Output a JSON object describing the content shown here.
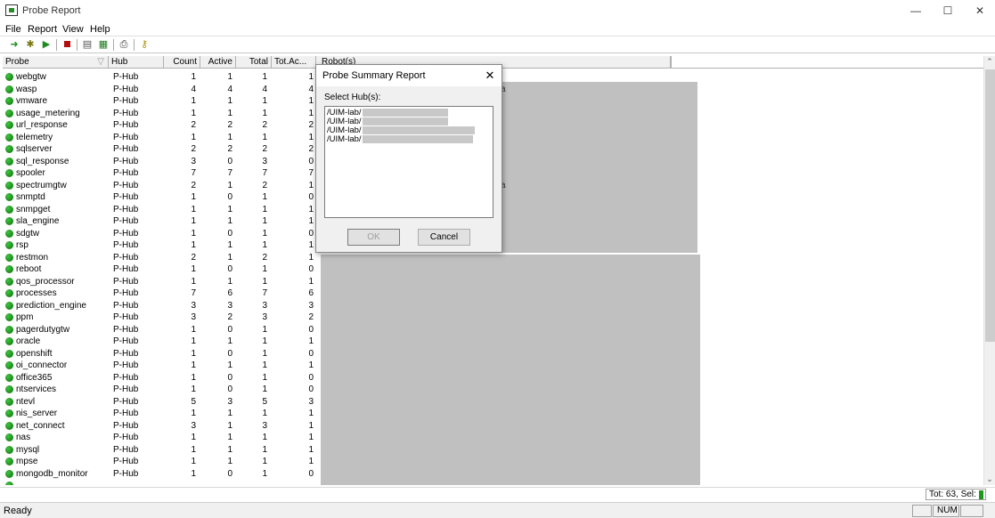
{
  "window": {
    "title": "Probe Report",
    "minimize": "—",
    "maximize": "☐",
    "close": "✕"
  },
  "menu": [
    "File",
    "Report",
    "View",
    "Help"
  ],
  "toolbar": {
    "buttons": [
      "run-green-icon",
      "settings-gear-icon",
      "forward-icon",
      "stop-red-icon",
      "print-preview-icon",
      "export-excel-icon",
      "print-icon",
      "key-icon"
    ]
  },
  "columns": {
    "probe": "Probe",
    "probe_sort": "▽",
    "hub": "Hub",
    "count": "Count",
    "active": "Active",
    "total": "Total",
    "totac": "Tot.Ac...",
    "robots": "Robot(s)"
  },
  "rows": [
    {
      "probe": "webgtw",
      "hub": "P-Hub",
      "count": "1",
      "active": "1",
      "total": "1",
      "totac": "1"
    },
    {
      "probe": "wasp",
      "hub": "P-Hub",
      "count": "4",
      "active": "4",
      "total": "4",
      "totac": "4"
    },
    {
      "probe": "vmware",
      "hub": "P-Hub",
      "count": "1",
      "active": "1",
      "total": "1",
      "totac": "1"
    },
    {
      "probe": "usage_metering",
      "hub": "P-Hub",
      "count": "1",
      "active": "1",
      "total": "1",
      "totac": "1"
    },
    {
      "probe": "url_response",
      "hub": "P-Hub",
      "count": "2",
      "active": "2",
      "total": "2",
      "totac": "2"
    },
    {
      "probe": "telemetry",
      "hub": "P-Hub",
      "count": "1",
      "active": "1",
      "total": "1",
      "totac": "1"
    },
    {
      "probe": "sqlserver",
      "hub": "P-Hub",
      "count": "2",
      "active": "2",
      "total": "2",
      "totac": "2"
    },
    {
      "probe": "sql_response",
      "hub": "P-Hub",
      "count": "3",
      "active": "0",
      "total": "3",
      "totac": "0"
    },
    {
      "probe": "spooler",
      "hub": "P-Hub",
      "count": "7",
      "active": "7",
      "total": "7",
      "totac": "7"
    },
    {
      "probe": "spectrumgtw",
      "hub": "P-Hub",
      "count": "2",
      "active": "1",
      "total": "2",
      "totac": "1"
    },
    {
      "probe": "snmptd",
      "hub": "P-Hub",
      "count": "1",
      "active": "0",
      "total": "1",
      "totac": "0"
    },
    {
      "probe": "snmpget",
      "hub": "P-Hub",
      "count": "1",
      "active": "1",
      "total": "1",
      "totac": "1"
    },
    {
      "probe": "sla_engine",
      "hub": "P-Hub",
      "count": "1",
      "active": "1",
      "total": "1",
      "totac": "1"
    },
    {
      "probe": "sdgtw",
      "hub": "P-Hub",
      "count": "1",
      "active": "0",
      "total": "1",
      "totac": "0"
    },
    {
      "probe": "rsp",
      "hub": "P-Hub",
      "count": "1",
      "active": "1",
      "total": "1",
      "totac": "1"
    },
    {
      "probe": "restmon",
      "hub": "P-Hub",
      "count": "2",
      "active": "1",
      "total": "2",
      "totac": "1"
    },
    {
      "probe": "reboot",
      "hub": "P-Hub",
      "count": "1",
      "active": "0",
      "total": "1",
      "totac": "0"
    },
    {
      "probe": "qos_processor",
      "hub": "P-Hub",
      "count": "1",
      "active": "1",
      "total": "1",
      "totac": "1"
    },
    {
      "probe": "processes",
      "hub": "P-Hub",
      "count": "7",
      "active": "6",
      "total": "7",
      "totac": "6"
    },
    {
      "probe": "prediction_engine",
      "hub": "P-Hub",
      "count": "3",
      "active": "3",
      "total": "3",
      "totac": "3"
    },
    {
      "probe": "ppm",
      "hub": "P-Hub",
      "count": "3",
      "active": "2",
      "total": "3",
      "totac": "2"
    },
    {
      "probe": "pagerdutygtw",
      "hub": "P-Hub",
      "count": "1",
      "active": "0",
      "total": "1",
      "totac": "0"
    },
    {
      "probe": "oracle",
      "hub": "P-Hub",
      "count": "1",
      "active": "1",
      "total": "1",
      "totac": "1"
    },
    {
      "probe": "openshift",
      "hub": "P-Hub",
      "count": "1",
      "active": "0",
      "total": "1",
      "totac": "0"
    },
    {
      "probe": "oi_connector",
      "hub": "P-Hub",
      "count": "1",
      "active": "1",
      "total": "1",
      "totac": "1"
    },
    {
      "probe": "office365",
      "hub": "P-Hub",
      "count": "1",
      "active": "0",
      "total": "1",
      "totac": "0"
    },
    {
      "probe": "ntservices",
      "hub": "P-Hub",
      "count": "1",
      "active": "0",
      "total": "1",
      "totac": "0"
    },
    {
      "probe": "ntevl",
      "hub": "P-Hub",
      "count": "5",
      "active": "3",
      "total": "5",
      "totac": "3"
    },
    {
      "probe": "nis_server",
      "hub": "P-Hub",
      "count": "1",
      "active": "1",
      "total": "1",
      "totac": "1"
    },
    {
      "probe": "net_connect",
      "hub": "P-Hub",
      "count": "3",
      "active": "1",
      "total": "3",
      "totac": "1"
    },
    {
      "probe": "nas",
      "hub": "P-Hub",
      "count": "1",
      "active": "1",
      "total": "1",
      "totac": "1"
    },
    {
      "probe": "mysql",
      "hub": "P-Hub",
      "count": "1",
      "active": "1",
      "total": "1",
      "totac": "1"
    },
    {
      "probe": "mpse",
      "hub": "P-Hub",
      "count": "1",
      "active": "1",
      "total": "1",
      "totac": "1"
    },
    {
      "probe": "mongodb_monitor",
      "hub": "P-Hub",
      "count": "1",
      "active": "0",
      "total": "1",
      "totac": "0"
    }
  ],
  "info": {
    "totals": "Tot: 63, Sel: 0"
  },
  "status": {
    "text": "Ready",
    "num": "NUM"
  },
  "dialog": {
    "title": "Probe Summary Report",
    "close": "✕",
    "label": "Select Hub(s):",
    "hubs": [
      "/UIM-lab/",
      "/UIM-lab/",
      "/UIM-lab/",
      "/UIM-lab/"
    ],
    "ok": "OK",
    "cancel": "Cancel"
  },
  "colors": {
    "status_dot": "#1a8f1a",
    "panel_gray": "#c0c0c0"
  }
}
